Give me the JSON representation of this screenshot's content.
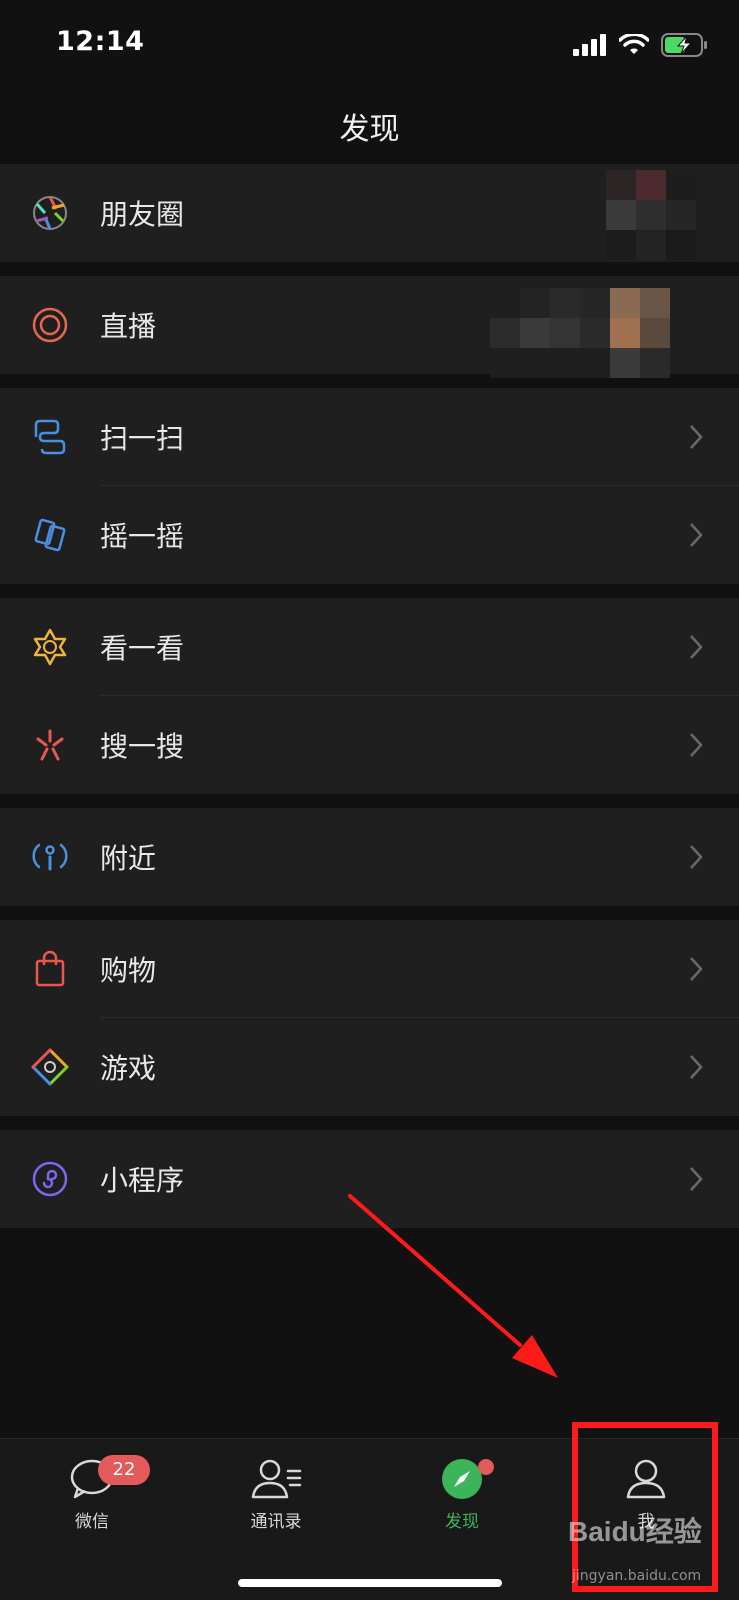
{
  "status": {
    "time": "12:14"
  },
  "header": {
    "title": "发现"
  },
  "menu": {
    "moments": "朋友圈",
    "live": "直播",
    "scan": "扫一扫",
    "shake": "摇一摇",
    "top_stories": "看一看",
    "search": "搜一搜",
    "nearby": "附近",
    "shopping": "购物",
    "games": "游戏",
    "mini_programs": "小程序"
  },
  "tabs": [
    {
      "label": "微信",
      "badge": "22",
      "icon": "chat-bubble-icon"
    },
    {
      "label": "通讯录",
      "icon": "contacts-icon"
    },
    {
      "label": "发现",
      "icon": "compass-icon",
      "active": true
    },
    {
      "label": "我",
      "icon": "person-icon"
    }
  ],
  "watermark": {
    "brand": "Baidu经验",
    "url": "jingyan.baidu.com"
  },
  "colors": {
    "background": "#111111",
    "row_background": "#1f1f1f",
    "accent_green": "#3cb45a",
    "badge_red": "#e35a5a",
    "annotation_red": "#ff1a1a"
  }
}
